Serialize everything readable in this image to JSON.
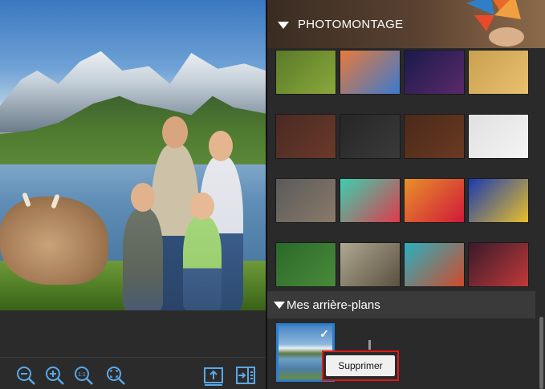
{
  "canvas": {
    "image_alt": "Family photomontage: mountains, lake and cow background"
  },
  "toolbar": {
    "items": [
      {
        "name": "zoom-out",
        "icon": "zoom-out-icon"
      },
      {
        "name": "zoom-in",
        "icon": "zoom-in-icon"
      },
      {
        "name": "zoom-actual-size",
        "icon": "zoom-1to1-icon",
        "label": "1:1"
      },
      {
        "name": "zoom-fit",
        "icon": "zoom-fit-icon"
      },
      {
        "name": "export",
        "icon": "export-icon"
      },
      {
        "name": "toggle-panel",
        "icon": "panel-toggle-icon"
      }
    ],
    "accent": "#5aa8e8"
  },
  "panel": {
    "photomontage_title": "PHOTOMONTAGE",
    "mes_title": "Mes arrière-plans",
    "tooltip_label": "Supprimer",
    "tiles": [
      {
        "name": "green-leaf",
        "colors": [
          "#5a7a2a",
          "#8aa83a"
        ]
      },
      {
        "name": "painted-wall",
        "colors": [
          "#e87a3a",
          "#3a7ad0"
        ]
      },
      {
        "name": "starry-sky",
        "colors": [
          "#1a1a4a",
          "#5a2a6a"
        ]
      },
      {
        "name": "gold-texture",
        "colors": [
          "#c9a050",
          "#e8c070"
        ]
      },
      {
        "name": "leather-tufted",
        "colors": [
          "#4a2a22",
          "#6a3a2a"
        ]
      },
      {
        "name": "black-fabric",
        "colors": [
          "#262626",
          "#3a3a3a"
        ]
      },
      {
        "name": "wood-planks",
        "colors": [
          "#4a2a1a",
          "#6a3a22"
        ]
      },
      {
        "name": "white-bricks",
        "colors": [
          "#e0e0e0",
          "#f4f4f4"
        ]
      },
      {
        "name": "stone-wall",
        "colors": [
          "#5a5a5a",
          "#8a7a6a"
        ]
      },
      {
        "name": "strawberries-teal",
        "colors": [
          "#3ad0b0",
          "#e03a4a"
        ]
      },
      {
        "name": "gerbera-flowers",
        "colors": [
          "#e8902a",
          "#d01a3a"
        ]
      },
      {
        "name": "abstract-paint",
        "colors": [
          "#1a3ab0",
          "#e8c02a"
        ]
      },
      {
        "name": "green-leaves",
        "colors": [
          "#2a6a2a",
          "#4a8a3a"
        ]
      },
      {
        "name": "torn-posters",
        "colors": [
          "#b0a890",
          "#5a5040"
        ]
      },
      {
        "name": "peeling-paint",
        "colors": [
          "#2ab0c0",
          "#d04a2a"
        ]
      },
      {
        "name": "light-trails",
        "colors": [
          "#3a1a2a",
          "#c03a3a"
        ]
      }
    ]
  }
}
